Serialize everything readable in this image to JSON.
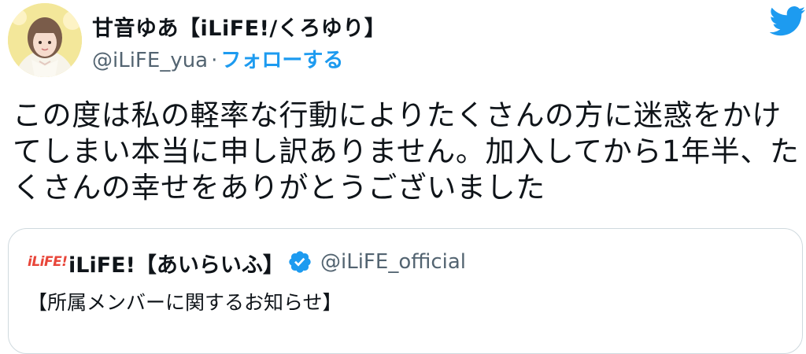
{
  "author": {
    "display_name": "甘音ゆあ【iLiFE!/くろゆり】",
    "handle": "@iLiFE_yua",
    "separator": "·",
    "follow_label": "フォローする"
  },
  "tweet": {
    "text": "この度は私の軽率な行動によりたくさんの方に迷惑をかけてしまい本当に申し訳ありません。加入してから1年半、たくさんの幸せをありがとうございました"
  },
  "quoted_tweet": {
    "logo_text": "iLiFE!",
    "display_name": "iLiFE!【あいらいふ】",
    "handle": "@iLiFE_official",
    "text": "【所属メンバーに関するお知らせ】"
  },
  "icons": {
    "brand": "twitter-bird-icon",
    "verified": "verified-badge-icon"
  },
  "colors": {
    "accent": "#1d9bf0",
    "muted": "#536471",
    "logo_red": "#e8463a"
  }
}
